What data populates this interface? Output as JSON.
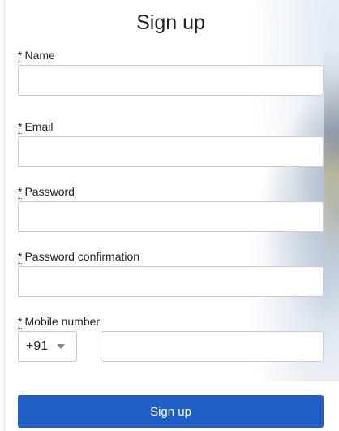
{
  "form": {
    "title": "Sign up",
    "required_marker": "*",
    "fields": {
      "name": {
        "label": "Name",
        "value": "",
        "placeholder": ""
      },
      "email": {
        "label": "Email",
        "value": "",
        "placeholder": ""
      },
      "password": {
        "label": "Password",
        "value": "",
        "placeholder": ""
      },
      "password_confirmation": {
        "label": "Password confirmation",
        "value": "",
        "placeholder": ""
      },
      "mobile": {
        "label": "Mobile number",
        "country_code": "+91",
        "value": "",
        "placeholder": ""
      }
    },
    "submit_label": "Sign up"
  },
  "colors": {
    "primary_button": "#1f5ec4",
    "input_border": "#c8ccd1"
  },
  "icons": {
    "select_caret": "chevron-down-icon"
  }
}
